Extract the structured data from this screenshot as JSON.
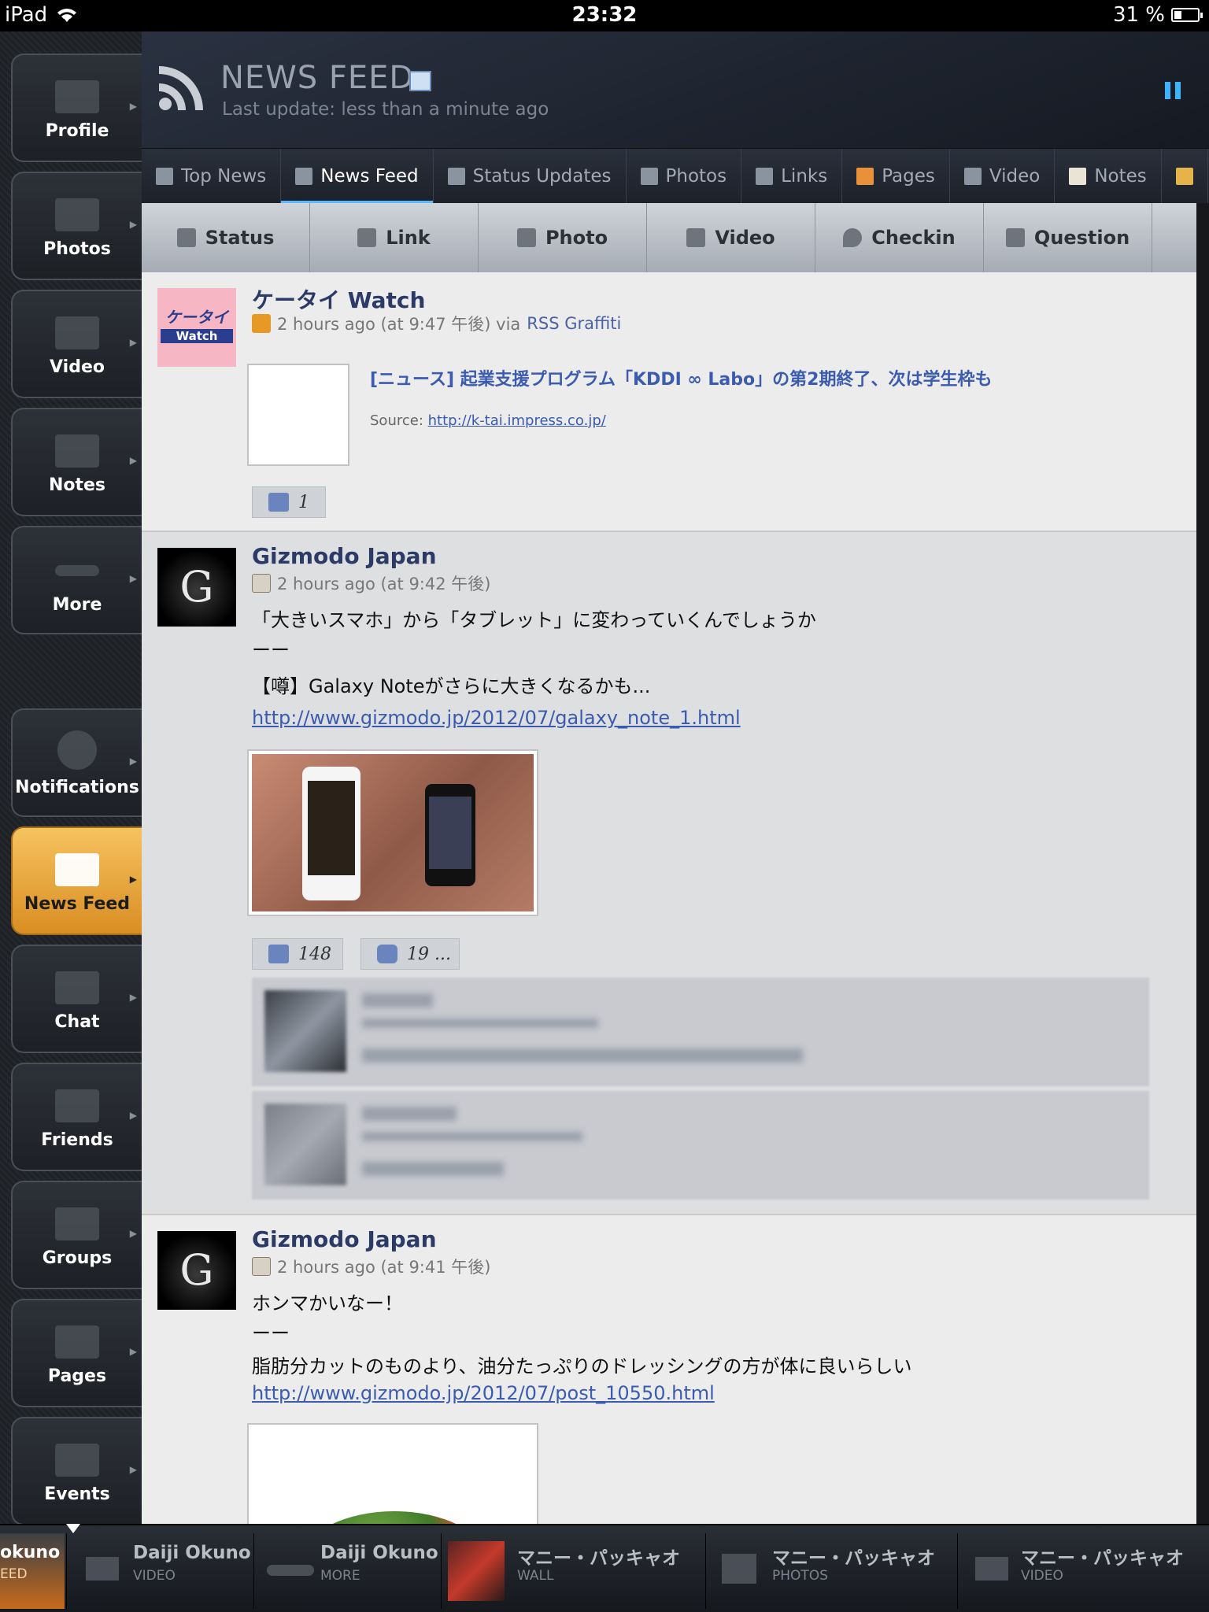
{
  "status_bar": {
    "device": "iPad",
    "time": "23:32",
    "battery": "31 %"
  },
  "sidebar": {
    "top_items": [
      {
        "label": "Profile"
      },
      {
        "label": "Photos"
      },
      {
        "label": "Video"
      },
      {
        "label": "Notes"
      },
      {
        "label": "More"
      }
    ],
    "bottom_items": [
      {
        "label": "Notifications"
      },
      {
        "label": "News Feed"
      },
      {
        "label": "Chat"
      },
      {
        "label": "Friends"
      },
      {
        "label": "Groups"
      },
      {
        "label": "Pages"
      },
      {
        "label": "Events"
      }
    ],
    "active": "News Feed"
  },
  "header": {
    "title": "NEWS FEED",
    "subtitle": "Last update: less than a minute ago"
  },
  "tabs": [
    {
      "label": "Top News"
    },
    {
      "label": "News Feed"
    },
    {
      "label": "Status Updates"
    },
    {
      "label": "Photos"
    },
    {
      "label": "Links"
    },
    {
      "label": "Pages"
    },
    {
      "label": "Video"
    },
    {
      "label": "Notes"
    }
  ],
  "active_tab": "News Feed",
  "actions": [
    {
      "label": "Status"
    },
    {
      "label": "Link"
    },
    {
      "label": "Photo"
    },
    {
      "label": "Video"
    },
    {
      "label": "Checkin"
    },
    {
      "label": "Question"
    }
  ],
  "posts": [
    {
      "author": "ケータイ Watch",
      "avatar_text": "ケータイ Watch",
      "time": "2 hours ago (at 9:47 午後) via",
      "via": "RSS Graffiti",
      "link_title": "[ニュース] 起業支援プログラム「KDDI ∞ Labo」の第2期終了、次は学生枠も",
      "source_label": "Source:",
      "source_url": "http://k-tai.impress.co.jp/",
      "likes": "1"
    },
    {
      "author": "Gizmodo Japan",
      "avatar_letter": "G",
      "time": "2 hours ago (at 9:42 午後)",
      "lines": [
        "「大きいスマホ」から「タブレット」に変わっていくんでしょうか",
        "ーー",
        "【噂】Galaxy Noteがさらに大きくなるかも..."
      ],
      "url": "http://www.gizmodo.jp/2012/07/galaxy_note_1.html",
      "likes": "148",
      "comments": "19 ..."
    },
    {
      "author": "Gizmodo Japan",
      "avatar_letter": "G",
      "time": "2 hours ago (at 9:41 午後)",
      "lines": [
        "ホンマかいなー！",
        "ーー",
        "脂肪分カットのものより、油分たっぷりのドレッシングの方が体に良いらしい"
      ],
      "url": "http://www.gizmodo.jp/2012/07/post_10550.html"
    }
  ],
  "bottom_bar": [
    {
      "name": "okuno",
      "sub": "EED"
    },
    {
      "name": "Daiji Okuno",
      "sub": "VIDEO"
    },
    {
      "name": "Daiji Okuno",
      "sub": "MORE"
    },
    {
      "name": "マニー・パッキャオ",
      "sub": "WALL"
    },
    {
      "name": "マニー・パッキャオ",
      "sub": "PHOTOS"
    },
    {
      "name": "マニー・パッキャオ",
      "sub": "VIDEO"
    }
  ]
}
